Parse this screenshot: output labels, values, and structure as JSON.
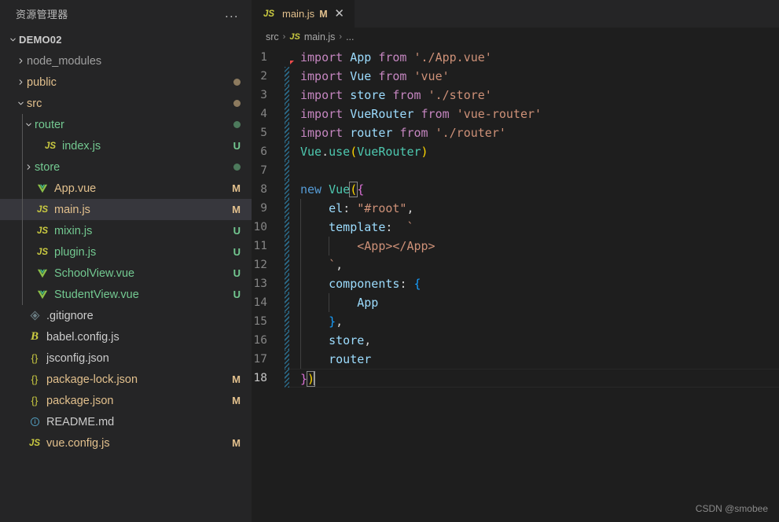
{
  "sidebar": {
    "title": "资源管理器",
    "more_actions": "...",
    "tree": [
      {
        "label": "DEMO02",
        "kind": "root",
        "indent": 0,
        "twisty": "down",
        "icon": "none",
        "badge": "",
        "dot": ""
      },
      {
        "label": "node_modules",
        "kind": "dim",
        "indent": 1,
        "twisty": "right",
        "icon": "none",
        "badge": "",
        "dot": ""
      },
      {
        "label": "public",
        "kind": "mod",
        "indent": 1,
        "twisty": "right",
        "icon": "none",
        "badge": "",
        "dot": "mod"
      },
      {
        "label": "src",
        "kind": "mod",
        "indent": 1,
        "twisty": "down",
        "icon": "none",
        "badge": "",
        "dot": "mod"
      },
      {
        "label": "router",
        "kind": "unt",
        "indent": 2,
        "twisty": "down",
        "icon": "none",
        "badge": "",
        "dot": "unt"
      },
      {
        "label": "index.js",
        "kind": "unt",
        "indent": 3,
        "twisty": "none",
        "icon": "js",
        "badge": "U",
        "dot": ""
      },
      {
        "label": "store",
        "kind": "unt",
        "indent": 2,
        "twisty": "right",
        "icon": "none",
        "badge": "",
        "dot": "unt"
      },
      {
        "label": "App.vue",
        "kind": "mod",
        "indent": 2,
        "twisty": "none",
        "icon": "vue",
        "badge": "M",
        "dot": ""
      },
      {
        "label": "main.js",
        "kind": "mod",
        "indent": 2,
        "twisty": "none",
        "icon": "js",
        "badge": "M",
        "dot": "",
        "selected": true
      },
      {
        "label": "mixin.js",
        "kind": "unt",
        "indent": 2,
        "twisty": "none",
        "icon": "js",
        "badge": "U",
        "dot": ""
      },
      {
        "label": "plugin.js",
        "kind": "unt",
        "indent": 2,
        "twisty": "none",
        "icon": "js",
        "badge": "U",
        "dot": ""
      },
      {
        "label": "SchoolView.vue",
        "kind": "unt",
        "indent": 2,
        "twisty": "none",
        "icon": "vue",
        "badge": "U",
        "dot": ""
      },
      {
        "label": "StudentView.vue",
        "kind": "unt",
        "indent": 2,
        "twisty": "none",
        "icon": "vue",
        "badge": "U",
        "dot": ""
      },
      {
        "label": ".gitignore",
        "kind": "plain",
        "indent": 1,
        "twisty": "none",
        "icon": "git",
        "badge": "",
        "dot": ""
      },
      {
        "label": "babel.config.js",
        "kind": "plain",
        "indent": 1,
        "twisty": "none",
        "icon": "babel",
        "badge": "",
        "dot": ""
      },
      {
        "label": "jsconfig.json",
        "kind": "plain",
        "indent": 1,
        "twisty": "none",
        "icon": "json",
        "badge": "",
        "dot": ""
      },
      {
        "label": "package-lock.json",
        "kind": "mod",
        "indent": 1,
        "twisty": "none",
        "icon": "json",
        "badge": "M",
        "dot": ""
      },
      {
        "label": "package.json",
        "kind": "mod",
        "indent": 1,
        "twisty": "none",
        "icon": "json",
        "badge": "M",
        "dot": ""
      },
      {
        "label": "README.md",
        "kind": "plain",
        "indent": 1,
        "twisty": "none",
        "icon": "md",
        "badge": "",
        "dot": ""
      },
      {
        "label": "vue.config.js",
        "kind": "mod",
        "indent": 1,
        "twisty": "none",
        "icon": "js",
        "badge": "M",
        "dot": ""
      }
    ]
  },
  "editor": {
    "tab": {
      "icon": "js",
      "label": "main.js",
      "badge": "M",
      "close": "✕"
    },
    "breadcrumb": [
      {
        "label": "src",
        "icon": "none"
      },
      {
        "label": "main.js",
        "icon": "js"
      },
      {
        "label": "...",
        "icon": "none"
      }
    ],
    "breadcrumb_separator": "›",
    "active_line": 18,
    "lines": [
      {
        "n": 1,
        "changed": false,
        "tokens": [
          {
            "t": "import ",
            "c": "kw"
          },
          {
            "t": "App",
            "c": "var"
          },
          {
            "t": " ",
            "c": "plain"
          },
          {
            "t": "from",
            "c": "kw"
          },
          {
            "t": " ",
            "c": "plain"
          },
          {
            "t": "'./App.vue'",
            "c": "str"
          }
        ]
      },
      {
        "n": 2,
        "changed": true,
        "tokens": [
          {
            "t": "import ",
            "c": "kw"
          },
          {
            "t": "Vue",
            "c": "var"
          },
          {
            "t": " ",
            "c": "plain"
          },
          {
            "t": "from",
            "c": "kw"
          },
          {
            "t": " ",
            "c": "plain"
          },
          {
            "t": "'vue'",
            "c": "str"
          }
        ]
      },
      {
        "n": 3,
        "changed": true,
        "tokens": [
          {
            "t": "import ",
            "c": "kw"
          },
          {
            "t": "store",
            "c": "var"
          },
          {
            "t": " ",
            "c": "plain"
          },
          {
            "t": "from",
            "c": "kw"
          },
          {
            "t": " ",
            "c": "plain"
          },
          {
            "t": "'./store'",
            "c": "str"
          }
        ]
      },
      {
        "n": 4,
        "changed": true,
        "tokens": [
          {
            "t": "import ",
            "c": "kw"
          },
          {
            "t": "VueRouter",
            "c": "var"
          },
          {
            "t": " ",
            "c": "plain"
          },
          {
            "t": "from",
            "c": "kw"
          },
          {
            "t": " ",
            "c": "plain"
          },
          {
            "t": "'vue-router'",
            "c": "str"
          }
        ]
      },
      {
        "n": 5,
        "changed": true,
        "tokens": [
          {
            "t": "import ",
            "c": "kw"
          },
          {
            "t": "router",
            "c": "var"
          },
          {
            "t": " ",
            "c": "plain"
          },
          {
            "t": "from",
            "c": "kw"
          },
          {
            "t": " ",
            "c": "plain"
          },
          {
            "t": "'./router'",
            "c": "str"
          }
        ]
      },
      {
        "n": 6,
        "changed": true,
        "tokens": [
          {
            "t": "Vue",
            "c": "fn"
          },
          {
            "t": ".",
            "c": "plain"
          },
          {
            "t": "use",
            "c": "fn"
          },
          {
            "t": "(",
            "c": "brk1"
          },
          {
            "t": "VueRouter",
            "c": "fn"
          },
          {
            "t": ")",
            "c": "brk1"
          }
        ]
      },
      {
        "n": 7,
        "changed": true,
        "tokens": []
      },
      {
        "n": 8,
        "changed": true,
        "tokens": [
          {
            "t": "new ",
            "c": "ctl"
          },
          {
            "t": "Vue",
            "c": "fn"
          },
          {
            "t": "(",
            "c": "brk1",
            "match": true
          },
          {
            "t": "{",
            "c": "brk2"
          }
        ]
      },
      {
        "n": 9,
        "changed": true,
        "tokens": [
          {
            "t": "    ",
            "c": "plain"
          },
          {
            "t": "el",
            "c": "var"
          },
          {
            "t": ": ",
            "c": "plain"
          },
          {
            "t": "\"#root\"",
            "c": "str"
          },
          {
            "t": ",",
            "c": "plain"
          }
        ]
      },
      {
        "n": 10,
        "changed": true,
        "tokens": [
          {
            "t": "    ",
            "c": "plain"
          },
          {
            "t": "template",
            "c": "var"
          },
          {
            "t": ":  ",
            "c": "plain"
          },
          {
            "t": "`",
            "c": "str"
          }
        ]
      },
      {
        "n": 11,
        "changed": true,
        "tokens": [
          {
            "t": "        ",
            "c": "plain"
          },
          {
            "t": "<App></App>",
            "c": "tag"
          }
        ]
      },
      {
        "n": 12,
        "changed": true,
        "tokens": [
          {
            "t": "    ",
            "c": "plain"
          },
          {
            "t": "`",
            "c": "str"
          },
          {
            "t": ",",
            "c": "plain"
          }
        ]
      },
      {
        "n": 13,
        "changed": true,
        "tokens": [
          {
            "t": "    ",
            "c": "plain"
          },
          {
            "t": "components",
            "c": "var"
          },
          {
            "t": ": ",
            "c": "plain"
          },
          {
            "t": "{",
            "c": "brk3"
          }
        ]
      },
      {
        "n": 14,
        "changed": true,
        "tokens": [
          {
            "t": "        ",
            "c": "plain"
          },
          {
            "t": "App",
            "c": "var"
          }
        ]
      },
      {
        "n": 15,
        "changed": true,
        "tokens": [
          {
            "t": "    ",
            "c": "plain"
          },
          {
            "t": "}",
            "c": "brk3"
          },
          {
            "t": ",",
            "c": "plain"
          }
        ]
      },
      {
        "n": 16,
        "changed": true,
        "tokens": [
          {
            "t": "    ",
            "c": "plain"
          },
          {
            "t": "store",
            "c": "var"
          },
          {
            "t": ",",
            "c": "plain"
          }
        ]
      },
      {
        "n": 17,
        "changed": true,
        "tokens": [
          {
            "t": "    ",
            "c": "plain"
          },
          {
            "t": "router",
            "c": "var"
          }
        ]
      },
      {
        "n": 18,
        "changed": true,
        "tokens": [
          {
            "t": "}",
            "c": "brk2"
          },
          {
            "t": ")",
            "c": "brk1",
            "match": true
          }
        ],
        "cursor": true
      }
    ]
  },
  "watermark": "CSDN @smobee"
}
